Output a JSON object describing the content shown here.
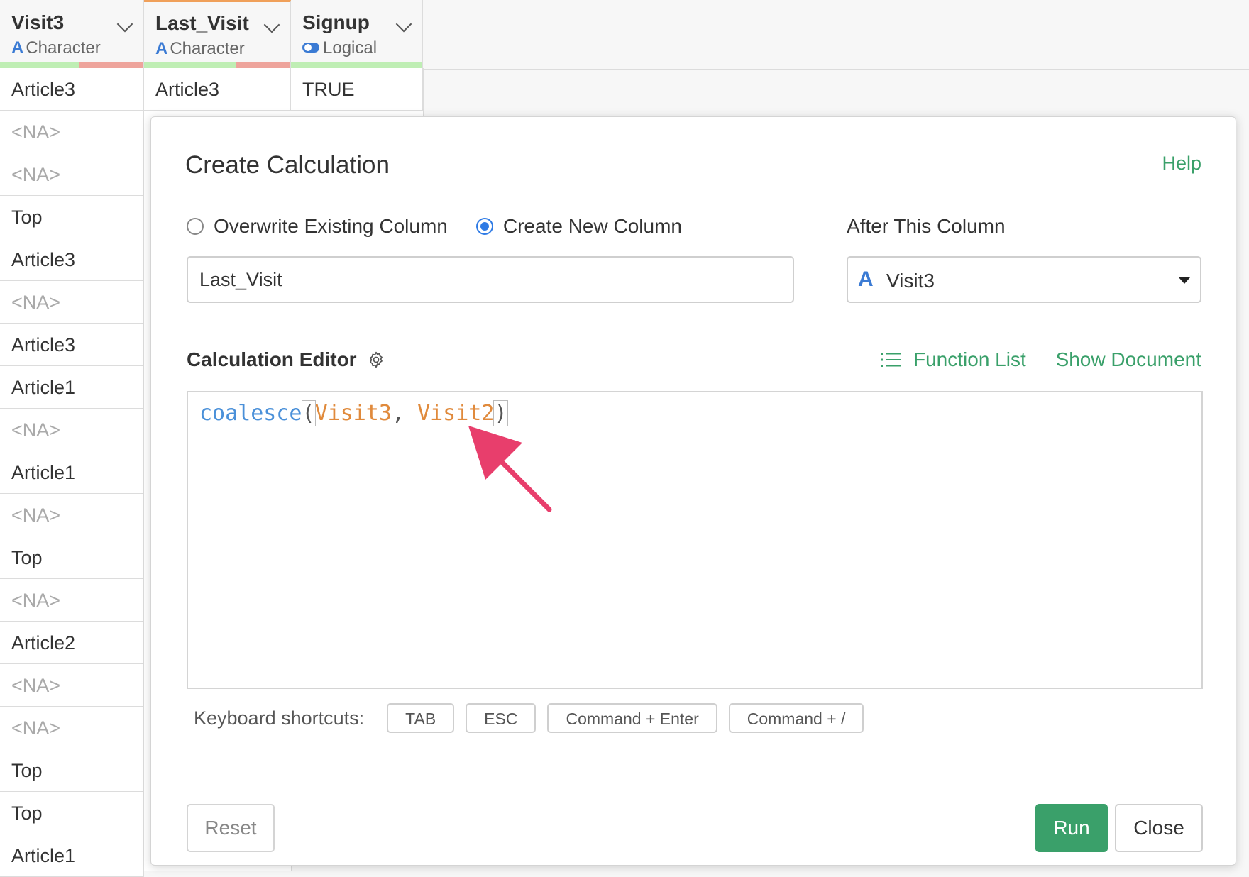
{
  "columns": [
    {
      "name": "Visit3",
      "type": "Character",
      "type_icon": "character-icon"
    },
    {
      "name": "Last_Visit",
      "type": "Character",
      "type_icon": "character-icon"
    },
    {
      "name": "Signup",
      "type": "Logical",
      "type_icon": "logical-toggle-icon"
    }
  ],
  "rows_col1": [
    "Article3",
    "<NA>",
    "<NA>",
    "Top",
    "Article3",
    "<NA>",
    "Article3",
    "Article1",
    "<NA>",
    "Article1",
    "<NA>",
    "Top",
    "<NA>",
    "Article2",
    "<NA>",
    "<NA>",
    "Top",
    "Top",
    "Article1"
  ],
  "row1_col2": "Article3",
  "row1_col3": "TRUE",
  "modal": {
    "title": "Create Calculation",
    "help": "Help",
    "radio_overwrite": "Overwrite Existing Column",
    "radio_create": "Create New Column",
    "after_label": "After This Column",
    "column_name_value": "Last_Visit",
    "after_select_value": "Visit3",
    "type_icon_letter": "A",
    "editor_label": "Calculation Editor",
    "function_list": "Function List",
    "show_document": "Show Document",
    "code": {
      "fn": "coalesce",
      "open": "(",
      "arg1": "Visit3",
      "sep": ", ",
      "arg2": "Visit2",
      "close": ")"
    },
    "shortcuts_label": "Keyboard shortcuts:",
    "shortcuts": [
      "TAB",
      "ESC",
      "Command + Enter",
      "Command + /"
    ],
    "reset": "Reset",
    "run": "Run",
    "close": "Close"
  },
  "colors": {
    "accent_green": "#3aa06a",
    "arrow": "#e83e6c",
    "type_blue": "#3b7bd4"
  }
}
